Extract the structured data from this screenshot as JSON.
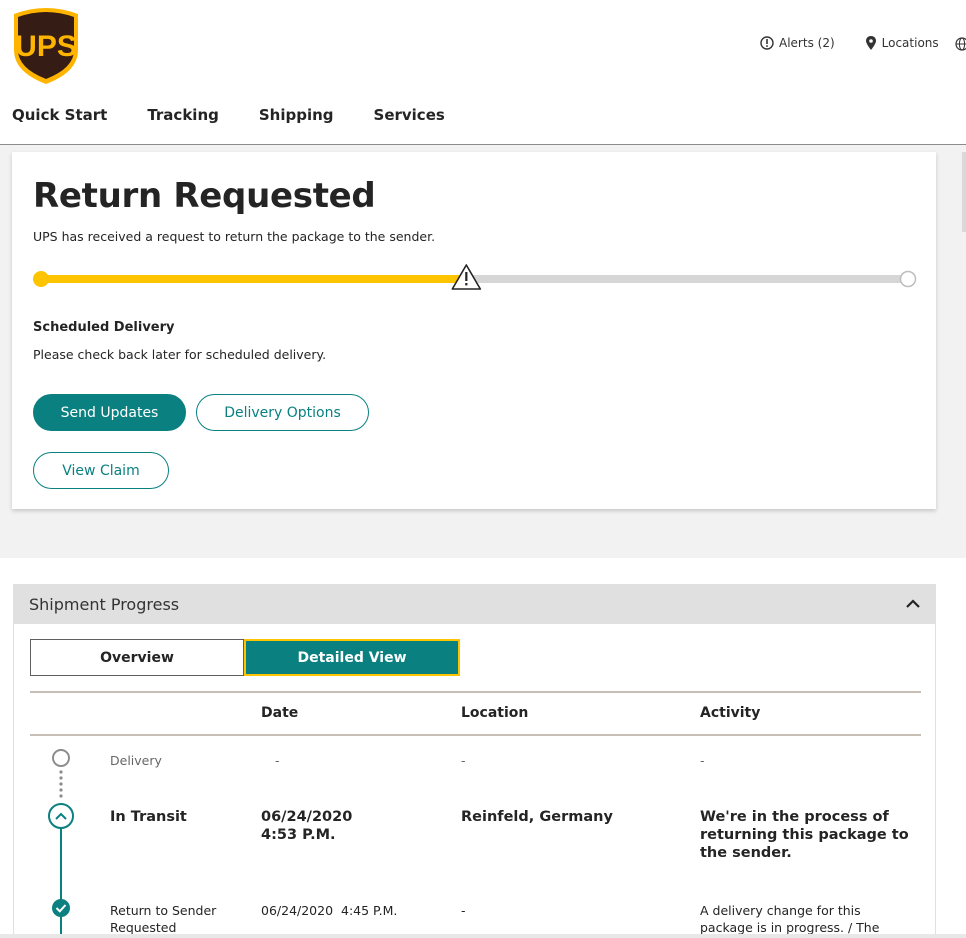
{
  "brand": {
    "logo_text": "UPS",
    "primary_color": "#351c15",
    "accent_color": "#ffc400",
    "action_color": "#0a8080"
  },
  "utilities": {
    "alerts": "Alerts (2)",
    "locations": "Locations"
  },
  "nav": [
    "Quick Start",
    "Tracking",
    "Shipping",
    "Services"
  ],
  "status": {
    "title": "Return Requested",
    "subtitle": "UPS has received a request to return the package to the sender.",
    "progress_fraction": 0.49,
    "progress_status_icon": "warning-icon"
  },
  "scheduled": {
    "heading": "Scheduled Delivery",
    "text": "Please check back later for scheduled delivery."
  },
  "buttons": {
    "send_updates": "Send Updates",
    "delivery_options": "Delivery Options",
    "view_claim": "View Claim"
  },
  "shipment_progress": {
    "title": "Shipment Progress",
    "tabs": {
      "overview": "Overview",
      "detailed": "Detailed View"
    },
    "columns": {
      "date": "Date",
      "location": "Location",
      "activity": "Activity"
    },
    "rows": [
      {
        "status": "Delivery",
        "date_line1": "-",
        "date_line2": "",
        "location": "-",
        "activity": "-"
      },
      {
        "status": "In Transit",
        "date_line1": "06/24/2020",
        "date_line2": "4:53 P.M.",
        "location": "Reinfeld, Germany",
        "activity": "We're in the process of returning this package to the sender."
      },
      {
        "status": "Return to Sender Requested",
        "date_line1": "06/24/2020  4:45 P.M.",
        "date_line2": "",
        "location": "-",
        "activity": "A delivery change for this package is in progress. / The"
      }
    ]
  }
}
